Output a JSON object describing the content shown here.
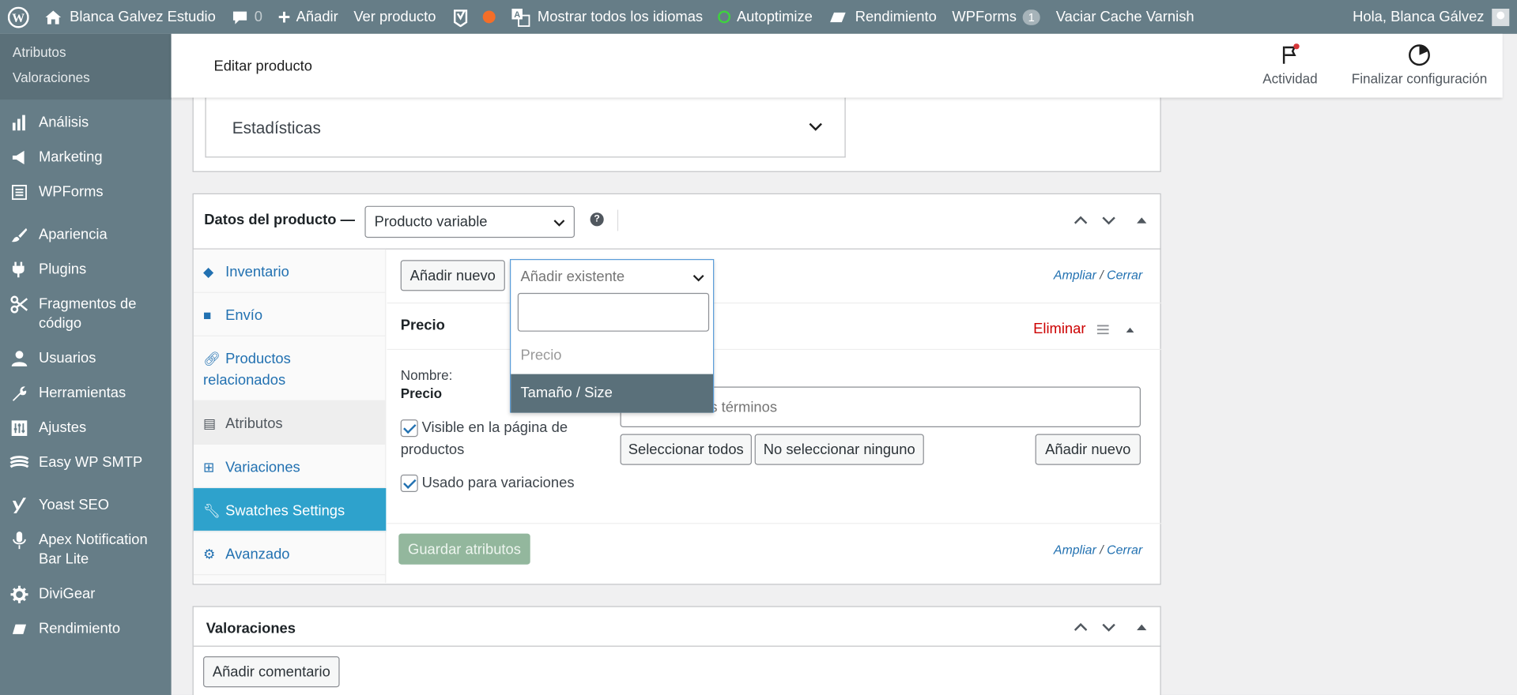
{
  "admin_bar": {
    "site_name": "Blanca Galvez Estudio",
    "comments_count": "0",
    "add_new": "Añadir",
    "view_product": "Ver producto",
    "languages": "Mostrar todos los idiomas",
    "autoptimize": "Autoptimize",
    "performance": "Rendimiento",
    "wpforms": "WPForms",
    "wpforms_count": "1",
    "varnish": "Vaciar Cache Varnish",
    "greeting": "Hola, Blanca Gálvez"
  },
  "sidebar": {
    "submenu": [
      "Atributos",
      "Valoraciones"
    ],
    "items": [
      {
        "label": "Análisis",
        "icon": "bar-chart-icon"
      },
      {
        "label": "Marketing",
        "icon": "megaphone-icon"
      },
      {
        "label": "WPForms",
        "icon": "forms-icon"
      },
      {
        "label": "Apariencia",
        "icon": "brush-icon"
      },
      {
        "label": "Plugins",
        "icon": "plugin-icon"
      },
      {
        "label": "Fragmentos de código",
        "icon": "scissors-icon"
      },
      {
        "label": "Usuarios",
        "icon": "user-icon"
      },
      {
        "label": "Herramientas",
        "icon": "wrench-icon"
      },
      {
        "label": "Ajustes",
        "icon": "settings-icon"
      },
      {
        "label": "Easy WP SMTP",
        "icon": "mail-icon"
      },
      {
        "label": "Yoast SEO",
        "icon": "yoast-icon"
      },
      {
        "label": "Apex Notification Bar Lite",
        "icon": "microphone-icon"
      },
      {
        "label": "DiviGear",
        "icon": "gear-icon"
      },
      {
        "label": "Rendimiento",
        "icon": "performance-icon"
      }
    ]
  },
  "header": {
    "title": "Editar producto",
    "activity": "Actividad",
    "finish_setup": "Finalizar configuración"
  },
  "stats": {
    "label": "Estadísticas"
  },
  "product_data": {
    "title": "Datos del producto —",
    "type_selected": "Producto variable",
    "help": "?",
    "tabs": [
      {
        "label": "Inventario",
        "icon": "tag-icon"
      },
      {
        "label": "Envío",
        "icon": "truck-icon"
      },
      {
        "label": "Productos relacionados",
        "icon": "link-icon"
      },
      {
        "label": "Atributos",
        "icon": "list-icon"
      },
      {
        "label": "Variaciones",
        "icon": "grid-icon"
      },
      {
        "label": "Swatches Settings",
        "icon": "wrench-icon"
      },
      {
        "label": "Avanzado",
        "icon": "gear-icon"
      }
    ],
    "add_new": "Añadir nuevo",
    "add_existing_placeholder": "Añadir existente",
    "expand": "Ampliar",
    "slash": "/",
    "close": "Cerrar",
    "dropdown_options": [
      "Precio",
      "Tamaño / Size"
    ],
    "attribute": {
      "name": "Precio",
      "remove": "Eliminar",
      "name_label": "Nombre:",
      "name_value": "Precio",
      "terms_placeholder_visible": "s términos",
      "visible_label": "Visible en la página de productos",
      "variations_label": "Usado para variaciones",
      "select_all": "Seleccionar todos",
      "select_none": "No seleccionar ninguno",
      "add_new": "Añadir nuevo"
    },
    "save_attributes": "Guardar atributos"
  },
  "reviews": {
    "title": "Valoraciones",
    "add_comment": "Añadir comentario"
  }
}
